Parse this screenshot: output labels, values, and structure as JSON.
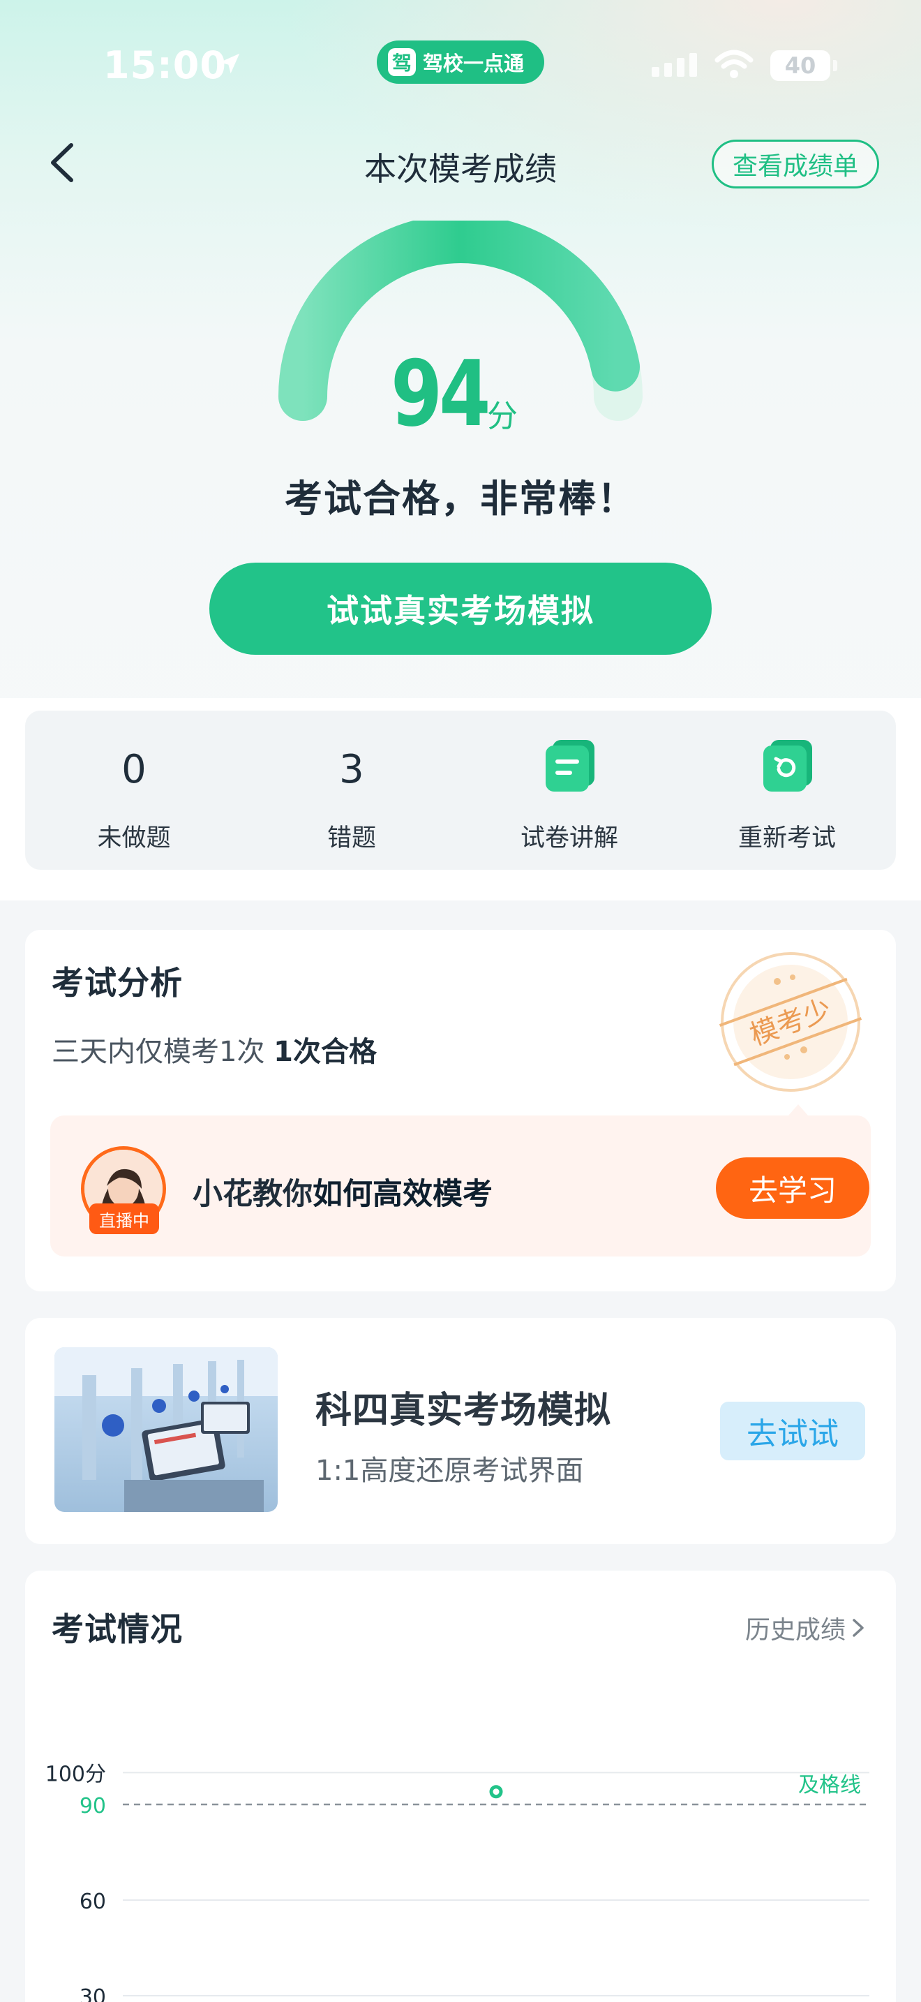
{
  "status_bar": {
    "time": "15:00",
    "app_badge_logo": "驾",
    "app_badge_text": "驾校一点通",
    "battery": "40"
  },
  "nav": {
    "title": "本次模考成绩",
    "report_button": "查看成绩单"
  },
  "result": {
    "score": "94",
    "score_unit": "分",
    "score_fraction": 0.94,
    "verdict": "考试合格，非常棒！",
    "simulate_button": "试试真实考场模拟",
    "accent_color": "#22c389"
  },
  "stats": [
    {
      "value": "0",
      "label": "未做题"
    },
    {
      "value": "3",
      "label": "错题"
    },
    {
      "label": "试卷讲解",
      "icon": "paper-explain-icon"
    },
    {
      "label": "重新考试",
      "icon": "retake-icon"
    }
  ],
  "analysis": {
    "title": "考试分析",
    "text_prefix": "三天内仅模考1次 ",
    "text_bold": "1次合格",
    "stamp": "模考少",
    "teach_badge": "直播中",
    "teach_prefix": "小花教你",
    "teach_bold": "如何高效模考",
    "teach_button": "去学习"
  },
  "simulation": {
    "title": "科四真实考场模拟",
    "subtitle": "1:1高度还原考试界面",
    "button": "去试试"
  },
  "exam_status": {
    "title": "考试情况",
    "history_link": "历史成绩",
    "chart_data": {
      "type": "scatter",
      "y_ticks": [
        "100分",
        "60",
        "30"
      ],
      "pass_line": {
        "value": 90,
        "label": "90",
        "name": "及格线"
      },
      "ylim": [
        0,
        100
      ],
      "points": [
        {
          "x": 1,
          "y": 94
        }
      ]
    }
  }
}
